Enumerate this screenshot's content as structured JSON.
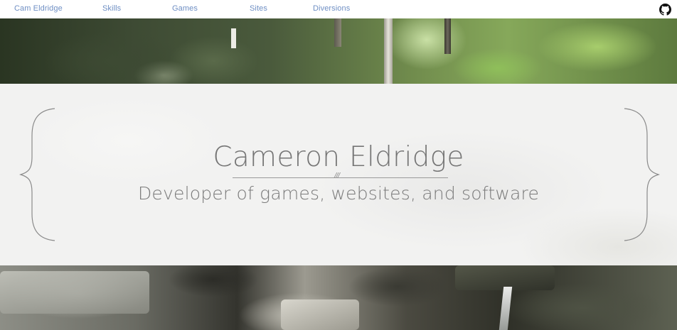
{
  "nav": {
    "items": [
      {
        "label": "Cam Eldridge"
      },
      {
        "label": "Skills"
      },
      {
        "label": "Games"
      },
      {
        "label": "Sites"
      },
      {
        "label": "Diversions"
      }
    ],
    "link_color": "#6f8fc4",
    "github_icon": "github-icon"
  },
  "hero": {
    "title": "Cameron Eldridge",
    "divider_mark": "///",
    "subtitle": "Developer of games, websites, and software",
    "text_color": "#757575",
    "background_color": "#f2f2f1"
  },
  "images": {
    "top": "forest-photo",
    "bottom": "waterfall-rocks-photo"
  }
}
